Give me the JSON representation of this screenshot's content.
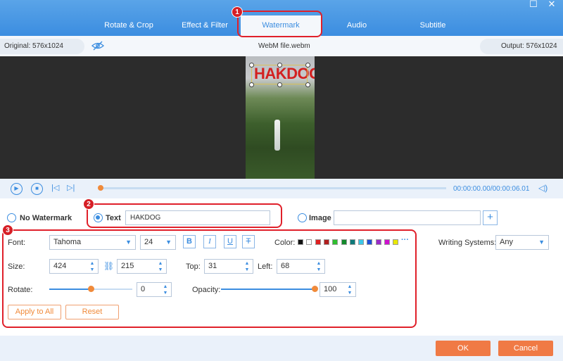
{
  "tabs": [
    {
      "label": "Rotate & Crop"
    },
    {
      "label": "Effect & Filter"
    },
    {
      "label": "Watermark"
    },
    {
      "label": "Audio"
    },
    {
      "label": "Subtitle"
    }
  ],
  "window": {
    "maximize_glyph": "☐",
    "close_glyph": "✕"
  },
  "info": {
    "original": "Original: 576x1024",
    "filename": "WebM file.webm",
    "output": "Output: 576x1024"
  },
  "preview": {
    "watermark_text": "HAKDOG"
  },
  "player": {
    "timecode": "00:00:00.00/00:00:06.01",
    "progress": 0.0
  },
  "watermark": {
    "no_watermark_label": "No Watermark",
    "text_label": "Text",
    "text_value": "HAKDOG",
    "image_label": "Image",
    "image_value": "",
    "selected": "text"
  },
  "font": {
    "font_label": "Font:",
    "font_value": "Tahoma",
    "size_value": "24",
    "bold": "B",
    "italic": "I",
    "underline": "U",
    "strike": "T",
    "color_label": "Color:",
    "colors": [
      "#111111",
      "#ffffff",
      "#e02020",
      "#b21e1e",
      "#2ec02e",
      "#138a2c",
      "#0e7a7a",
      "#3bc8e8",
      "#1f4fd8",
      "#9a2bc9",
      "#d010d0",
      "#e8e800"
    ],
    "more": "···",
    "writing_label": "Writing Systems:",
    "writing_value": "Any"
  },
  "geometry_fields": {
    "size_label": "Size:",
    "width": "424",
    "height": "215",
    "top_label": "Top:",
    "top": "31",
    "left_label": "Left:",
    "left": "68"
  },
  "adjust": {
    "rotate_label": "Rotate:",
    "rotate_value": "0",
    "rotate_level": 0.5,
    "opacity_label": "Opacity:",
    "opacity_value": "100",
    "opacity_level": 1.0
  },
  "actions": {
    "apply_all": "Apply to All",
    "reset": "Reset"
  },
  "badges": [
    "1",
    "2",
    "3"
  ],
  "footer": {
    "ok": "OK",
    "cancel": "Cancel"
  },
  "colors": {
    "accent": "#3b8de0",
    "orange": "#f07a45",
    "highlight": "#e0202a"
  }
}
